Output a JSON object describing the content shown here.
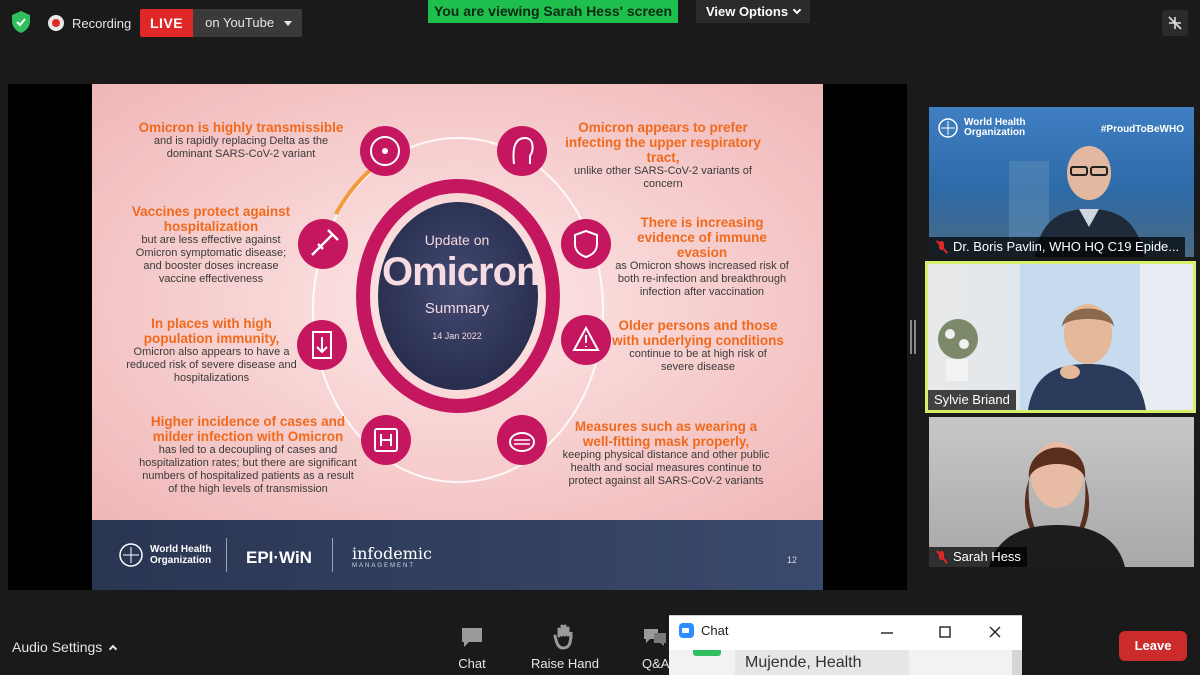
{
  "topbar": {
    "recording_label": "Recording",
    "live_badge": "LIVE",
    "live_destination": "on YouTube",
    "viewing_banner": "You are viewing Sarah Hess' screen",
    "view_options": "View Options"
  },
  "slide": {
    "center": {
      "line1": "Update on",
      "line2": "Omicron",
      "line3": "Summary",
      "date": "14 Jan 2022"
    },
    "cards": [
      {
        "heading": "Omicron is highly transmissible",
        "body": "and is rapidly replacing Delta as the dominant SARS-CoV-2 variant"
      },
      {
        "heading": "Vaccines protect against hospitalization",
        "body": "but are less effective against Omicron symptomatic disease; and booster doses increase vaccine effectiveness"
      },
      {
        "heading": "In places with high population immunity,",
        "body": "Omicron also appears to have a reduced risk of severe disease and hospitalizations"
      },
      {
        "heading": "Higher incidence of cases and milder infection with Omicron",
        "body": "has led to a decoupling of cases and hospitalization rates; but there are significant numbers of hospitalized patients as a result of the high levels of transmission"
      },
      {
        "heading": "Omicron appears to prefer infecting the upper respiratory tract,",
        "body": "unlike other SARS-CoV-2 variants of concern"
      },
      {
        "heading": "There is increasing evidence of immune evasion",
        "body": "as Omicron shows increased risk of both re-infection and breakthrough infection after vaccination"
      },
      {
        "heading": "Older persons and those with underlying conditions",
        "body": "continue to be at high risk of severe disease"
      },
      {
        "heading": "Measures such as wearing a well-fitting mask properly,",
        "body": "keeping physical distance and other public health and social measures continue to protect against all SARS-CoV-2 variants"
      }
    ],
    "footer": {
      "who_line1": "World Health",
      "who_line2": "Organization",
      "epiwin": "EPI·WiN",
      "infodemic": "infodemic",
      "infodemic_sub": "MANAGEMENT",
      "page_number": "12"
    }
  },
  "participants": [
    {
      "name": "Dr. Boris Pavlin, WHO HQ C19 Epide...",
      "muted": true,
      "logo_line1": "World Health",
      "logo_line2": "Organization",
      "tag": "#ProudToBeWHO"
    },
    {
      "name": "Sylvie Briand",
      "muted": false,
      "active_speaker": true
    },
    {
      "name": "Sarah Hess",
      "muted": true
    }
  ],
  "toolbar": {
    "audio_settings": "Audio Settings",
    "chat": "Chat",
    "raise_hand": "Raise Hand",
    "qa": "Q&A",
    "leave": "Leave"
  },
  "chat_window": {
    "title": "Chat",
    "message_preview": "Mujende, Health"
  },
  "colors": {
    "live_red": "#e02828",
    "banner_green": "#1fbf4d",
    "slide_orange": "#ef6a1d",
    "slide_magenta": "#c5175f",
    "active_speaker_border": "#d7f06a",
    "leave_red": "#cc2b2b"
  }
}
